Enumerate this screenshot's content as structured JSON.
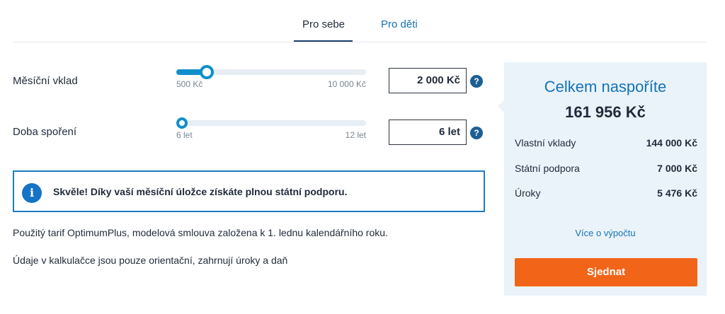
{
  "tabs": [
    {
      "label": "Pro sebe",
      "active": true
    },
    {
      "label": "Pro děti",
      "active": false
    }
  ],
  "monthly_deposit": {
    "label": "Měsíční vklad",
    "min_label": "500 Kč",
    "max_label": "10 000 Kč",
    "value_display": "2 000 Kč",
    "slider_fraction": 0.16,
    "help": "?"
  },
  "saving_period": {
    "label": "Doba spoření",
    "min_label": "6 let",
    "max_label": "12 let",
    "value_display": "6 let",
    "slider_fraction": 0.0,
    "help": "?"
  },
  "info": {
    "icon": "info-icon",
    "glyph": "i",
    "text": "Skvěle! Díky vaší měsíční úložce získáte plnou státní podporu."
  },
  "notes": [
    "Použitý tarif OptimumPlus, modelová smlouva založena k 1. lednu kalendářního roku.",
    "Údaje v kalkulačce jsou pouze orientační, zahrnují úroky a daň"
  ],
  "summary": {
    "title": "Celkem naspoříte",
    "total": "161 956 Kč",
    "rows": [
      {
        "label": "Vlastní vklady",
        "value": "144 000 Kč"
      },
      {
        "label": "Státní podpora",
        "value": "7 000 Kč"
      },
      {
        "label": "Úroky",
        "value": "5 476 Kč"
      }
    ],
    "more_link": "Více o výpočtu",
    "cta": "Sjednat"
  },
  "colors": {
    "accent": "#1473b8",
    "slider": "#0f8fcc",
    "cta": "#f26418",
    "panel_bg": "#eaf3fa"
  }
}
